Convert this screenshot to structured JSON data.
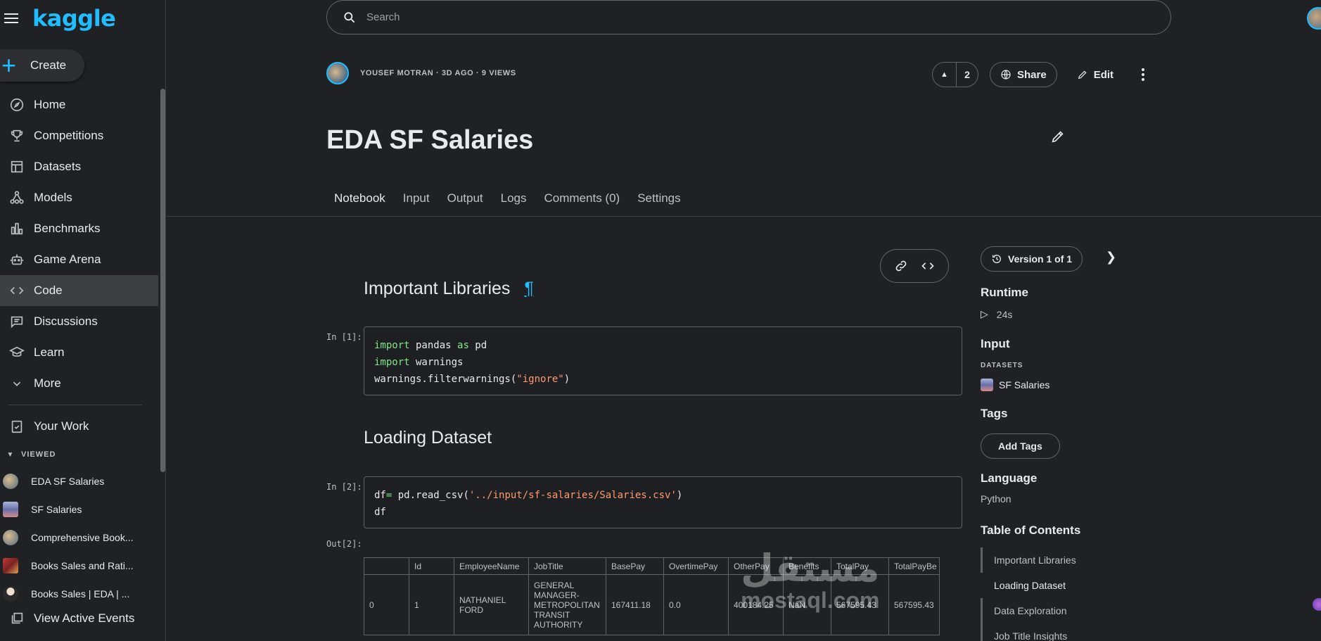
{
  "brand": {
    "logo": "kaggle",
    "accent": "#20beff"
  },
  "sidebar": {
    "create_label": "Create",
    "items": [
      {
        "label": "Home",
        "icon": "compass-icon"
      },
      {
        "label": "Competitions",
        "icon": "trophy-icon"
      },
      {
        "label": "Datasets",
        "icon": "table-icon"
      },
      {
        "label": "Models",
        "icon": "models-icon"
      },
      {
        "label": "Benchmarks",
        "icon": "bar-chart-icon"
      },
      {
        "label": "Game Arena",
        "icon": "robot-icon"
      },
      {
        "label": "Code",
        "icon": "code-icon"
      },
      {
        "label": "Discussions",
        "icon": "comments-icon"
      },
      {
        "label": "Learn",
        "icon": "school-icon"
      },
      {
        "label": "More",
        "icon": "chevron-down-icon"
      }
    ],
    "your_work": "Your Work",
    "viewed_header": "VIEWED",
    "viewed": [
      "EDA SF Salaries",
      "SF Salaries",
      "Comprehensive Book...",
      "Books Sales and Rati...",
      "Books Sales | EDA | ..."
    ],
    "active_events": "View Active Events"
  },
  "search": {
    "placeholder": "Search"
  },
  "header": {
    "meta": "YOUSEF MOTRAN · 3D AGO · 9 VIEWS",
    "votes": "2",
    "share": "Share",
    "edit": "Edit",
    "title": "EDA SF Salaries"
  },
  "tabs": [
    "Notebook",
    "Input",
    "Output",
    "Logs",
    "Comments (0)",
    "Settings"
  ],
  "notebook": {
    "h_libraries": "Important Libraries",
    "pilcrow": "¶",
    "prompt1": "In [1]:",
    "code1": {
      "l1_kw1": "import",
      "l1_mid": " pandas ",
      "l1_kw2": "as",
      "l1_end": " pd",
      "l2_kw": "import",
      "l2_end": " warnings",
      "l3_a": "warnings.filterwarnings(",
      "l3_str": "\"ignore\"",
      "l3_b": ")"
    },
    "h_loading": "Loading Dataset",
    "prompt2": "In [2]:",
    "code2": {
      "l1_a": "df",
      "l1_op": "=",
      "l1_b": " pd.read_csv(",
      "l1_str": "'../input/sf-salaries/Salaries.csv'",
      "l1_c": ")",
      "l2": "df"
    },
    "out2": "Out[2]:",
    "table": {
      "columns": [
        "",
        "Id",
        "EmployeeName",
        "JobTitle",
        "BasePay",
        "OvertimePay",
        "OtherPay",
        "Benefits",
        "TotalPay",
        "TotalPayBe"
      ],
      "row": [
        "0",
        "1",
        "NATHANIEL FORD",
        "GENERAL MANAGER-METROPOLITAN TRANSIT AUTHORITY",
        "167411.18",
        "0.0",
        "400184.25",
        "NaN",
        "567595.43",
        "567595.43"
      ]
    }
  },
  "right_panel": {
    "version": "Version 1 of 1",
    "runtime_h": "Runtime",
    "runtime_v": "24s",
    "input_h": "Input",
    "datasets_sub": "DATASETS",
    "dataset": "SF Salaries",
    "tags_h": "Tags",
    "add_tags": "Add Tags",
    "language_h": "Language",
    "language_v": "Python",
    "toc_h": "Table of Contents",
    "toc": [
      "Important Libraries",
      "Loading Dataset",
      "Data Exploration",
      "Job Title Insights"
    ]
  },
  "watermark": {
    "arabic": "مستقل",
    "latin": "mostaql.com"
  }
}
